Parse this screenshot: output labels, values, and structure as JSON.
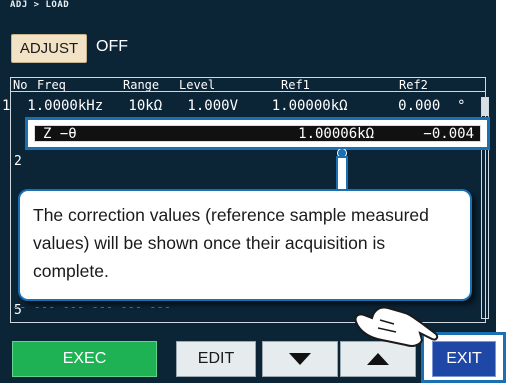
{
  "breadcrumb": "ADJ > LOAD",
  "adjust": {
    "label": "ADJUST",
    "status": "OFF"
  },
  "table": {
    "headers": [
      "No",
      "Freq",
      "Range",
      "Level",
      "Ref1",
      "Ref2"
    ],
    "row1": "1  1.0000kHz   10kΩ   1.000V    1.00000kΩ      0.000  °",
    "row_numbers": [
      "2",
      "5"
    ]
  },
  "highlight": {
    "param": "Z −θ",
    "ref1": "1.00006kΩ",
    "ref2": "−0.004"
  },
  "callout": {
    "text": "The correction values (reference sample measured values) will be shown once their acquisition is complete."
  },
  "ghost_row": "-- ---          ---  ---    ---     ---",
  "buttons": {
    "exec": "EXEC",
    "edit": "EDIT",
    "exit": "EXIT"
  },
  "icons": {
    "down": "down-arrow-icon",
    "up": "up-arrow-icon",
    "hand": "pointing-hand-icon"
  },
  "colors": {
    "screen_bg": "#0b2436",
    "exec": "#1fb255",
    "exit": "#1f47a6",
    "accent": "#1b6fb3",
    "adjust_btn": "#f3e3c6"
  }
}
